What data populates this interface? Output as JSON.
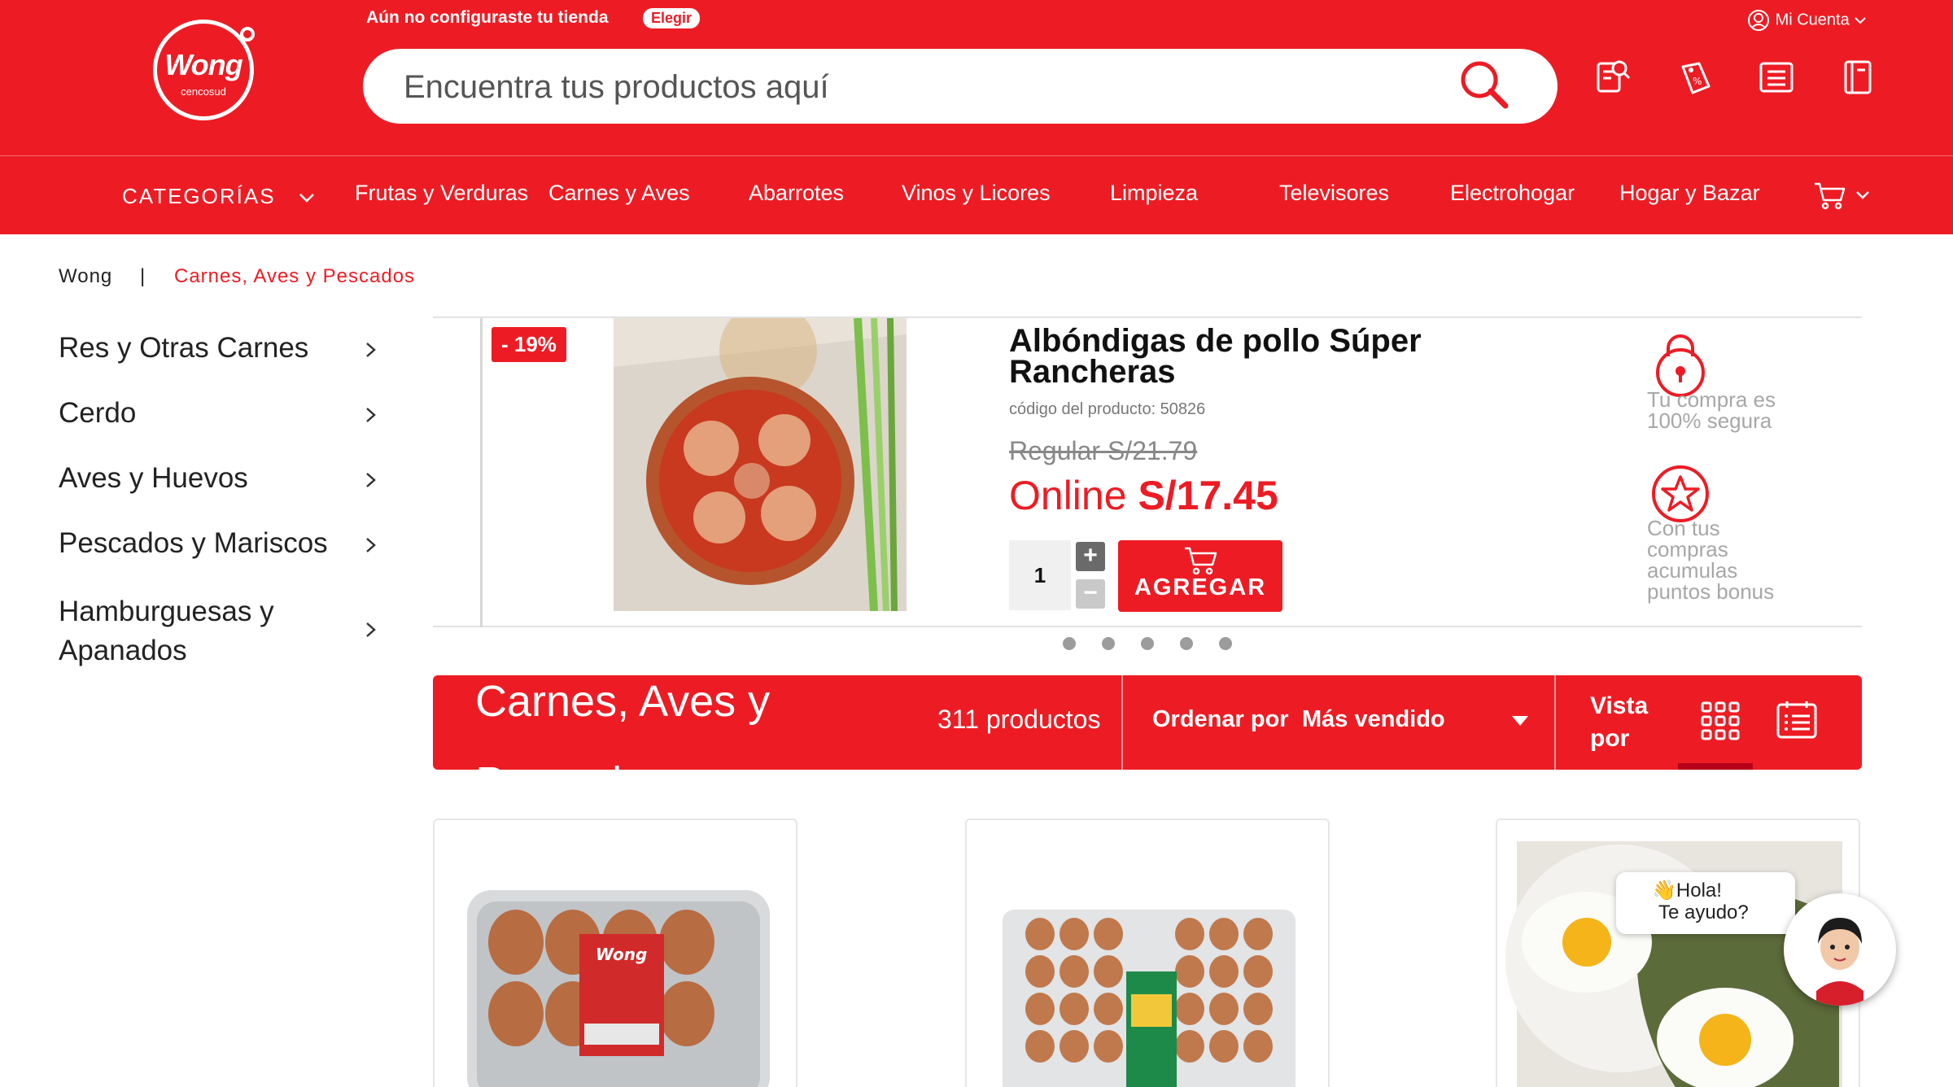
{
  "header": {
    "logo_text": "Wong",
    "logo_sub": "cencosud",
    "store_message": "Aún no configuraste tu tienda",
    "store_button": "Elegir",
    "search_placeholder": "Encuentra tus productos aquí",
    "account_label": "Mi Cuenta",
    "header_icons": [
      "receipt-search-icon",
      "discount-tag-icon",
      "list-icon",
      "book-icon"
    ]
  },
  "nav": {
    "categories_label": "CATEGORÍAS",
    "items": [
      "Frutas y Verduras",
      "Carnes y Aves",
      "Abarrotes",
      "Vinos y Licores",
      "Limpieza",
      "Televisores",
      "Electrohogar",
      "Hogar y Bazar"
    ],
    "cart_icon": "cart-icon"
  },
  "breadcrumb": {
    "home": "Wong",
    "separator": "|",
    "current": "Carnes, Aves y Pescados"
  },
  "sidebar": {
    "items": [
      {
        "label": "Res y Otras Carnes"
      },
      {
        "label": "Cerdo"
      },
      {
        "label": "Aves y Huevos"
      },
      {
        "label": "Pescados y Mariscos"
      },
      {
        "label": "Hamburguesas y Apanados"
      }
    ]
  },
  "banner": {
    "discount": "- 19%",
    "title": "Albóndigas de pollo Súper Rancheras",
    "code": "código del producto: 50826",
    "regular_price": "Regular S/21.79",
    "online_label": "Online",
    "online_price": "S/17.45",
    "quantity": "1",
    "plus": "+",
    "minus": "−",
    "add_button": "AGREGAR",
    "trust_1": "Tu compra es 100% segura",
    "trust_2": "Con tus compras acumulas puntos bonus",
    "slide_count": 5,
    "active_slide": 0
  },
  "results": {
    "title": "Carnes, Aves y Pescados",
    "count": "311 productos",
    "sort_label": "Ordenar por",
    "sort_value": "Más vendido",
    "view_label": "Vista por",
    "active_view": "grid"
  },
  "chat": {
    "line1": "👋Hola!",
    "line2": "Te ayudo?"
  },
  "colors": {
    "brand_red": "#ed1c24",
    "white": "#ffffff"
  }
}
